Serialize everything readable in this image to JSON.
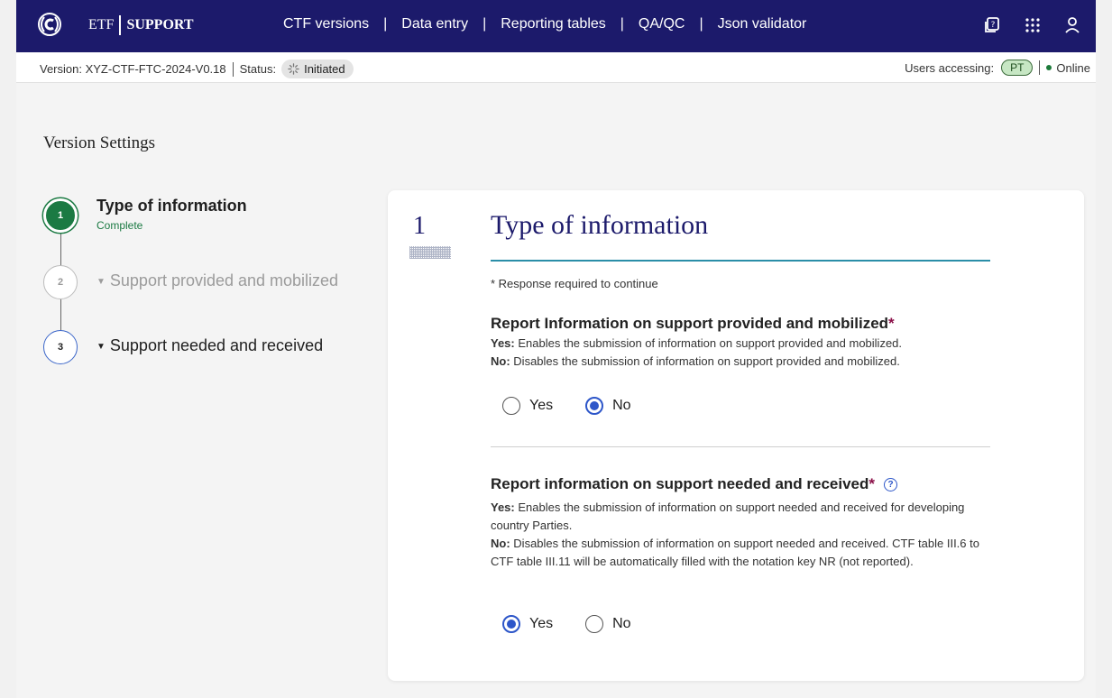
{
  "header": {
    "brand_prefix": "ETF",
    "brand_name": "SUPPORT",
    "nav": [
      {
        "label": "CTF versions"
      },
      {
        "label": "Data entry"
      },
      {
        "label": "Reporting tables"
      },
      {
        "label": "QA/QC"
      },
      {
        "label": "Json validator"
      }
    ],
    "separator": "|",
    "icons": [
      "help-book-icon",
      "apps-grid-icon",
      "user-icon"
    ]
  },
  "status_bar": {
    "version_label": "Version: XYZ-CTF-FTC-2024-V0.18",
    "status_label": "Status:",
    "status_value": "Initiated",
    "users_label": "Users accessing:",
    "user_initials": "PT",
    "online_label": "Online",
    "colors": {
      "online": "#1c7a3a",
      "user_pill": "#c7e7c4"
    }
  },
  "page": {
    "title": "Version Settings"
  },
  "stepper": {
    "steps": [
      {
        "number": "1",
        "title": "Type of information",
        "subtitle": "Complete",
        "state": "complete"
      },
      {
        "number": "2",
        "title": "Support provided and mobilized",
        "state": "disabled"
      },
      {
        "number": "3",
        "title": "Support needed and received",
        "state": "active"
      }
    ]
  },
  "section": {
    "number": "1",
    "title": "Type of information",
    "required_note": "* Response required to continue",
    "questions": [
      {
        "title": "Report Information on support provided and mobilized",
        "star": "*",
        "yes_desc_label": "Yes:",
        "yes_desc": "Enables the submission of information on support provided and mobilized.",
        "no_desc_label": "No:",
        "no_desc": "Disables the submission of information on support provided and mobilized.",
        "options": [
          "Yes",
          "No"
        ],
        "selected": "No"
      },
      {
        "title": "Report information on support needed and received",
        "star": "*",
        "help": "?",
        "yes_desc_label": "Yes:",
        "yes_desc": "Enables the submission of information on support needed and received for developing country Parties.",
        "no_desc_label": "No:",
        "no_desc": "Disables the submission of information on support needed and received. CTF table III.6 to CTF table III.11 will be automatically filled with the notation key NR (not reported).",
        "options": [
          "Yes",
          "No"
        ],
        "selected": "Yes"
      }
    ]
  },
  "colors": {
    "nav_bg": "#1c1a6b",
    "accent": "#2d56c9",
    "complete": "#1b7a43",
    "rule": "#2a8ea8",
    "required_star": "#8b1048"
  }
}
